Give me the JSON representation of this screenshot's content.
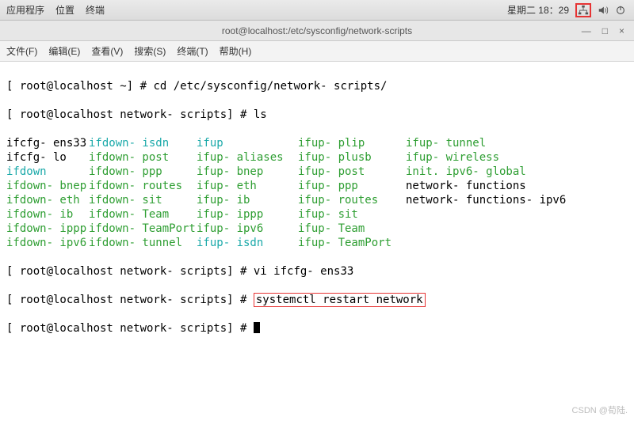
{
  "topbar": {
    "apps": "应用程序",
    "places": "位置",
    "terminal": "终端",
    "datetime": "星期二 18：29",
    "net_icon": "network-icon",
    "vol_icon": "volume-icon",
    "power_icon": "power-icon"
  },
  "window": {
    "title": "root@localhost:/etc/sysconfig/network-scripts",
    "min": "—",
    "max": "□",
    "close": "×"
  },
  "menu": {
    "file": "文件(F)",
    "edit": "编辑(E)",
    "view": "查看(V)",
    "search": "搜索(S)",
    "terminal": "终端(T)",
    "help": "帮助(H)"
  },
  "term": {
    "l1a": "[ root@localhost ~] # ",
    "l1b": "cd /etc/sysconfig/network- scripts/",
    "l2a": "[ root@localhost network- scripts] # ",
    "l2b": "ls",
    "files": [
      [
        {
          "t": "ifcfg- ens33",
          "c": ""
        },
        {
          "t": "ifdown- isdn",
          "c": "t-cyan"
        },
        {
          "t": "ifup",
          "c": "t-cyan"
        },
        {
          "t": "ifup- plip",
          "c": "t-green"
        },
        {
          "t": "ifup- tunnel",
          "c": "t-green"
        }
      ],
      [
        {
          "t": "ifcfg- lo",
          "c": ""
        },
        {
          "t": "ifdown- post",
          "c": "t-green"
        },
        {
          "t": "ifup- aliases",
          "c": "t-green"
        },
        {
          "t": "ifup- plusb",
          "c": "t-green"
        },
        {
          "t": "ifup- wireless",
          "c": "t-green"
        }
      ],
      [
        {
          "t": "ifdown",
          "c": "t-cyan"
        },
        {
          "t": "ifdown- ppp",
          "c": "t-green"
        },
        {
          "t": "ifup- bnep",
          "c": "t-green"
        },
        {
          "t": "ifup- post",
          "c": "t-green"
        },
        {
          "t": "init. ipv6- global",
          "c": "t-green"
        }
      ],
      [
        {
          "t": "ifdown- bnep",
          "c": "t-green"
        },
        {
          "t": "ifdown- routes",
          "c": "t-green"
        },
        {
          "t": "ifup- eth",
          "c": "t-green"
        },
        {
          "t": "ifup- ppp",
          "c": "t-green"
        },
        {
          "t": "network- functions",
          "c": ""
        }
      ],
      [
        {
          "t": "ifdown- eth",
          "c": "t-green"
        },
        {
          "t": "ifdown- sit",
          "c": "t-green"
        },
        {
          "t": "ifup- ib",
          "c": "t-green"
        },
        {
          "t": "ifup- routes",
          "c": "t-green"
        },
        {
          "t": "network- functions- ipv6",
          "c": ""
        }
      ],
      [
        {
          "t": "ifdown- ib",
          "c": "t-green"
        },
        {
          "t": "ifdown- Team",
          "c": "t-green"
        },
        {
          "t": "ifup- ippp",
          "c": "t-green"
        },
        {
          "t": "ifup- sit",
          "c": "t-green"
        },
        {
          "t": "",
          "c": ""
        }
      ],
      [
        {
          "t": "ifdown- ippp",
          "c": "t-green"
        },
        {
          "t": "ifdown- TeamPort",
          "c": "t-green"
        },
        {
          "t": "ifup- ipv6",
          "c": "t-green"
        },
        {
          "t": "ifup- Team",
          "c": "t-green"
        },
        {
          "t": "",
          "c": ""
        }
      ],
      [
        {
          "t": "ifdown- ipv6",
          "c": "t-green"
        },
        {
          "t": "ifdown- tunnel",
          "c": "t-green"
        },
        {
          "t": "ifup- isdn",
          "c": "t-cyan"
        },
        {
          "t": "ifup- TeamPort",
          "c": "t-green"
        },
        {
          "t": "",
          "c": ""
        }
      ]
    ],
    "l3a": "[ root@localhost network- scripts] # ",
    "l3b": "vi ifcfg- ens33",
    "l4a": "[ root@localhost network- scripts] # ",
    "l4b": "systemctl restart network",
    "l5a": "[ root@localhost network- scripts] # "
  },
  "watermark": "CSDN @荀陆."
}
